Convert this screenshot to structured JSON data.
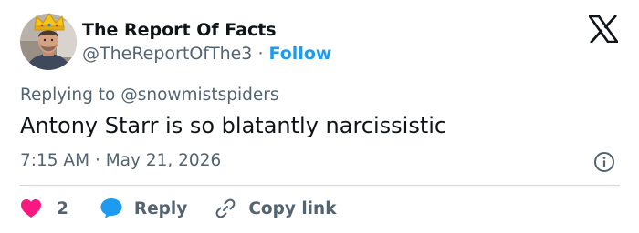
{
  "author": {
    "name": "The Report Of Facts",
    "handle": "@TheReportOfThe3",
    "separator": "·",
    "follow_label": "Follow",
    "avatar_icon": "avatar-with-crown",
    "verified_badge": "crown-icon"
  },
  "platform_icon": "x-logo-icon",
  "tweet": {
    "replying_to_prefix": "Replying to",
    "replying_to_handle": "@snowmistspiders",
    "text": "Antony Starr is so blatantly narcissistic",
    "time": "7:15 AM",
    "separator": "·",
    "date": "May 21, 2026",
    "info_icon": "info-icon"
  },
  "actions": {
    "like_icon": "heart-icon",
    "like_count": "2",
    "reply_icon": "speech-bubble-icon",
    "reply_label": "Reply",
    "copy_icon": "link-icon",
    "copy_label": "Copy link"
  },
  "colors": {
    "text_primary": "#0f1419",
    "text_secondary": "#536471",
    "accent_blue": "#1d9bf0",
    "like_pink": "#f91880",
    "divider": "#cfd9de",
    "crown_gold": "#f5c518"
  }
}
